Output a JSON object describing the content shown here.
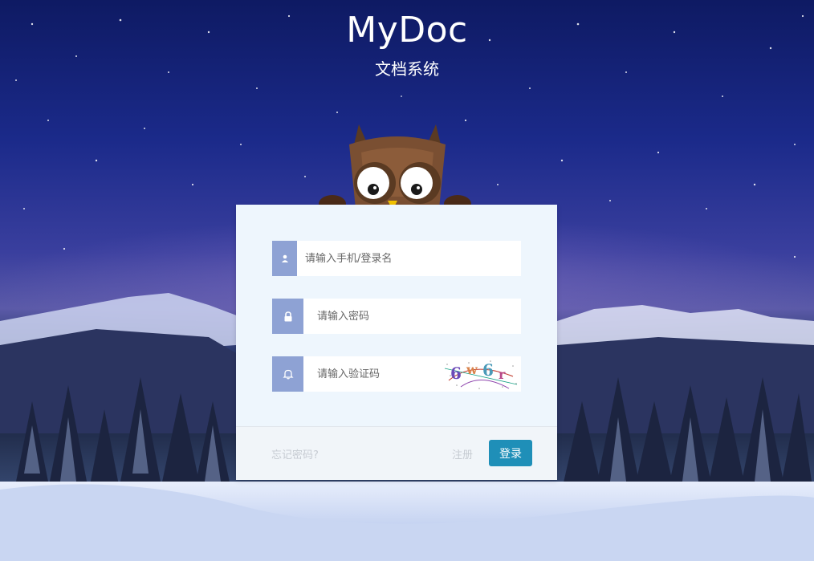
{
  "header": {
    "title": "MyDoc",
    "subtitle": "文档系统"
  },
  "form": {
    "username_placeholder": "请输入手机/登录名",
    "password_placeholder": "请输入密码",
    "captcha_placeholder": "请输入验证码",
    "captcha_text": "6w6r"
  },
  "footer": {
    "forgot_label": "忘记密码?",
    "register_label": "注册",
    "login_label": "登录"
  },
  "icons": {
    "user": "user-icon",
    "lock": "lock-icon",
    "bell": "bell-icon"
  },
  "colors": {
    "accent": "#1f8fb8",
    "addon": "#8ea2d4",
    "panel": "#eef6fd"
  }
}
